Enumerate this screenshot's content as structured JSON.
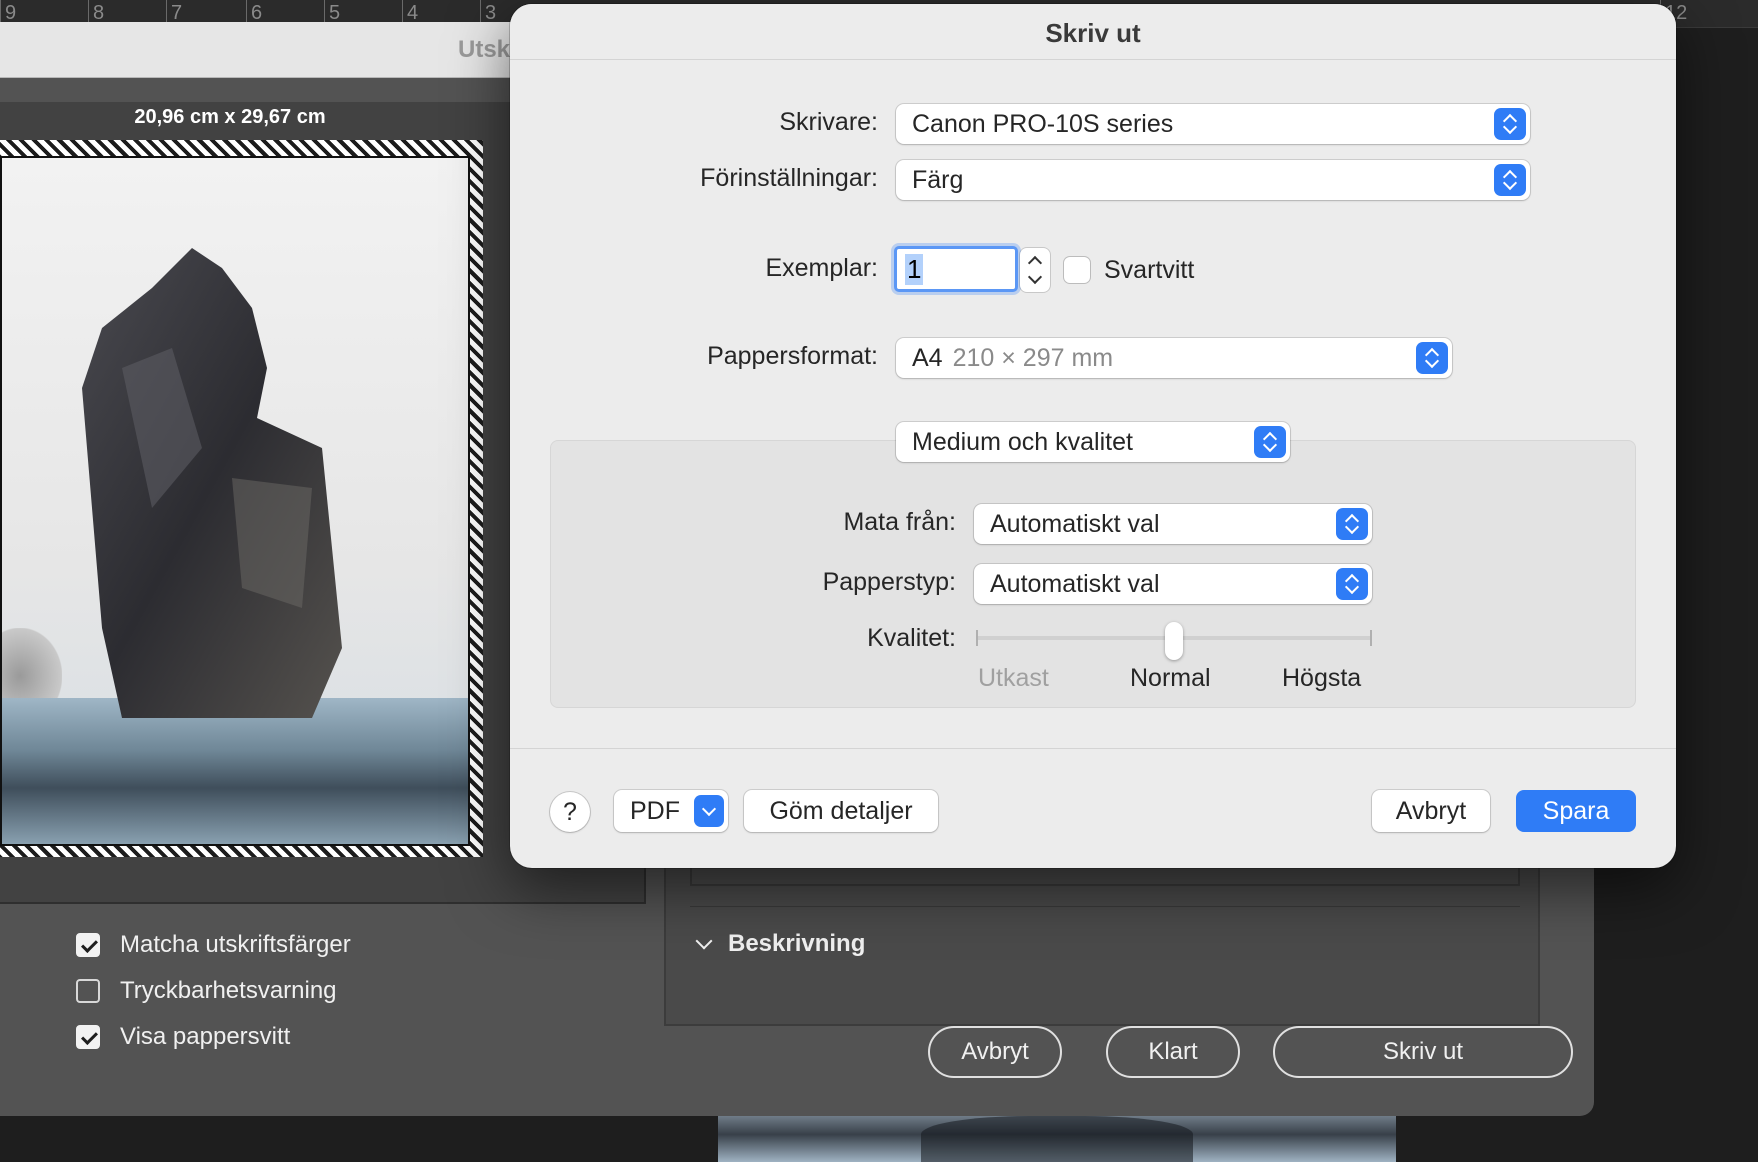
{
  "ruler": {
    "labels": [
      "9",
      "8",
      "7",
      "6",
      "5",
      "4",
      "3",
      "12"
    ]
  },
  "ps_window": {
    "title": "Utsk",
    "dimensions": "20,96 cm x 29,67 cm",
    "options": [
      {
        "label": "Matcha utskriftsfärger",
        "checked": true
      },
      {
        "label": "Tryckbarhetsvarning",
        "checked": false
      },
      {
        "label": "Visa pappersvitt",
        "checked": true
      }
    ],
    "section_title": "Beskrivning",
    "buttons": {
      "cancel": "Avbryt",
      "done": "Klart",
      "print": "Skriv ut"
    }
  },
  "dialog": {
    "title": "Skriv ut",
    "printer": {
      "label": "Skrivare:",
      "value": "Canon PRO-10S series"
    },
    "presets": {
      "label": "Förinställningar:",
      "value": "Färg"
    },
    "copies": {
      "label": "Exemplar:",
      "value": "1"
    },
    "black_white": {
      "label": "Svartvitt",
      "checked": false
    },
    "paper_size": {
      "label": "Pappersformat:",
      "name": "A4",
      "size": "210 × 297 mm"
    },
    "section_menu": "Medium och kvalitet",
    "feed": {
      "label": "Mata från:",
      "value": "Automatiskt val"
    },
    "paper_type": {
      "label": "Papperstyp:",
      "value": "Automatiskt val"
    },
    "quality": {
      "label": "Kvalitet:",
      "stops": [
        "Utkast",
        "Normal",
        "Högsta"
      ],
      "selected": "Normal"
    },
    "footer": {
      "help": "?",
      "pdf": "PDF",
      "hide_details": "Göm detaljer",
      "cancel": "Avbryt",
      "save": "Spara"
    }
  },
  "colors": {
    "accent": "#2f7cf6",
    "dialog_bg": "#ececec",
    "app_bg": "#535353"
  }
}
